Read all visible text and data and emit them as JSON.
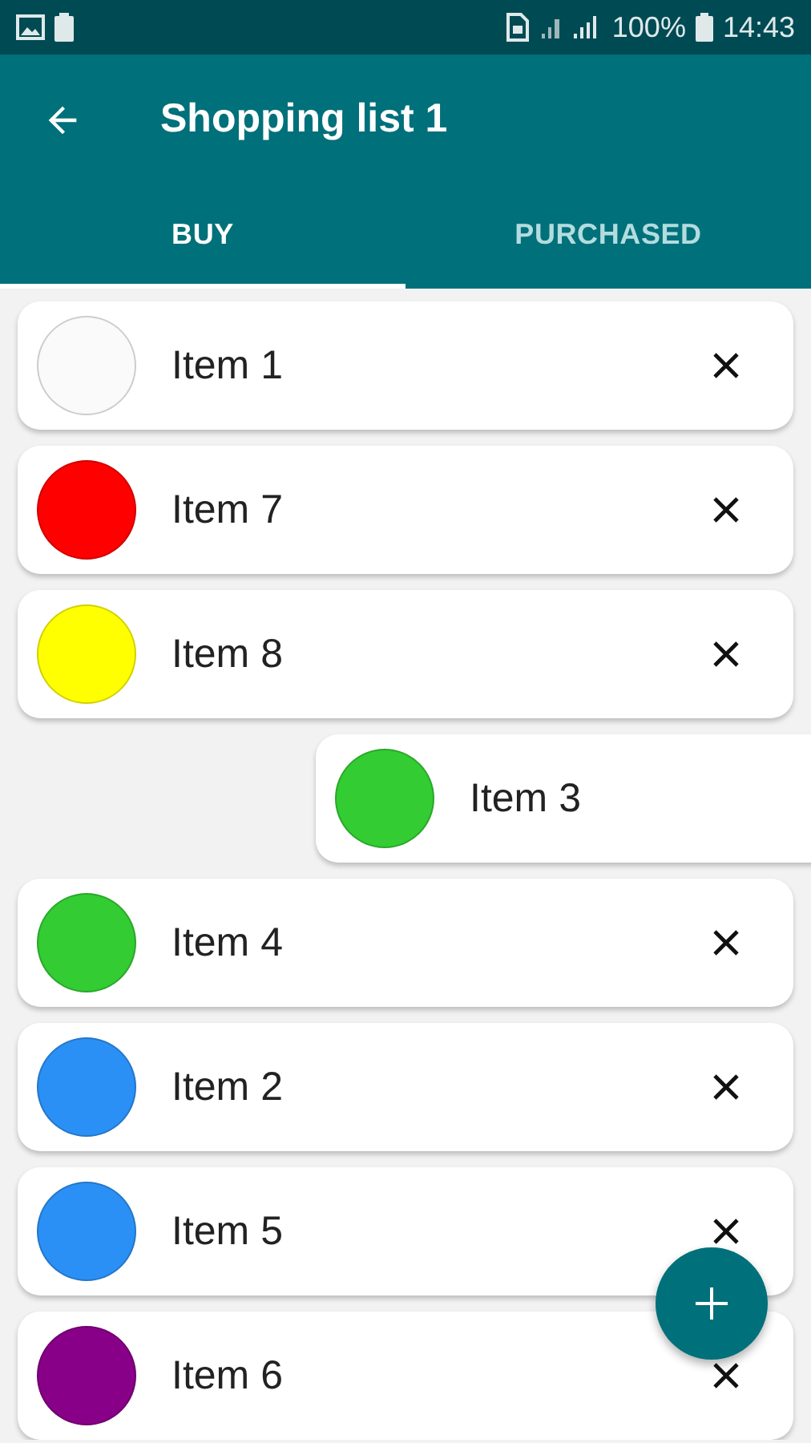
{
  "status_bar": {
    "battery": "100%",
    "time": "14:43"
  },
  "toolbar": {
    "title": "Shopping list 1"
  },
  "tabs": [
    {
      "label": "BUY",
      "selected": true
    },
    {
      "label": "PURCHASED",
      "selected": false
    }
  ],
  "items": [
    {
      "name": "Item 1",
      "color": "#fafafa",
      "swiped": false
    },
    {
      "name": "Item 7",
      "color": "#ff0000",
      "swiped": false
    },
    {
      "name": "Item 8",
      "color": "#ffff00",
      "swiped": false
    },
    {
      "name": "Item 3",
      "color": "#33cc33",
      "swiped": true
    },
    {
      "name": "Item 4",
      "color": "#33cc33",
      "swiped": false
    },
    {
      "name": "Item 2",
      "color": "#2b90f5",
      "swiped": false
    },
    {
      "name": "Item 5",
      "color": "#2b90f5",
      "swiped": false
    },
    {
      "name": "Item 6",
      "color": "#880088",
      "swiped": false
    }
  ]
}
